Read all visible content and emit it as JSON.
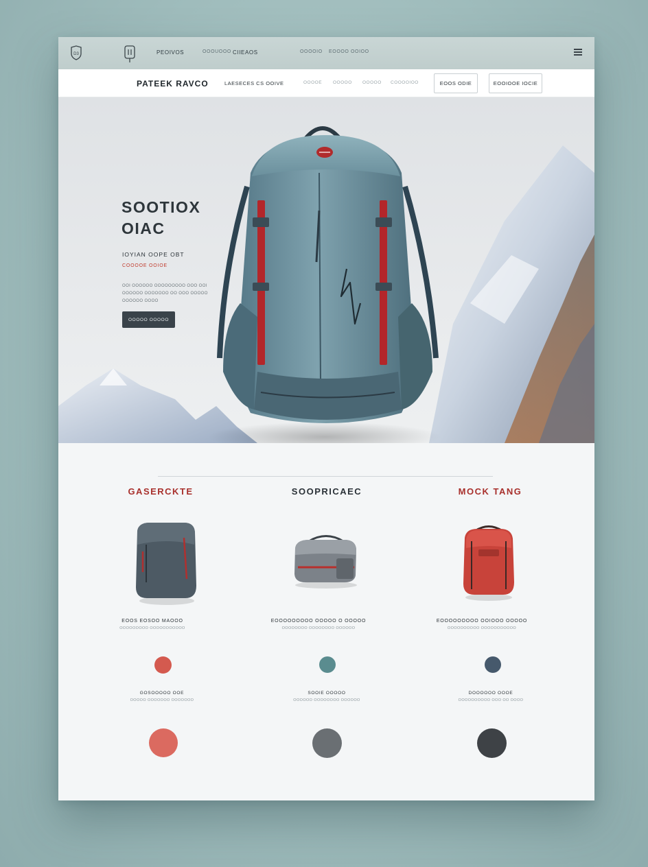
{
  "topbar": {
    "links": [
      "PEOIVOS",
      "OOOUOOO",
      "CIIEAOS",
      "OOOOIO",
      "EOOOO OOIOO"
    ]
  },
  "nav": {
    "brand": "PATEEK RAVCO",
    "primary_link": "LAESECES CS OOIVE",
    "faint_links": [
      "OOOOE",
      "OOOOO",
      "OOOOO",
      "COOOOIOO"
    ],
    "buttons": [
      "EOOS ODIE",
      "EOOIOOE IOCIE"
    ]
  },
  "hero": {
    "title_line1": "SOOTIOX",
    "title_line2": "OIAC",
    "subtitle": "IOYIAN OOPE OBT",
    "tag": "COOOOE OOIOE",
    "desc_lines": [
      "OOI OOOOOO OOOOOOOOO OOO OOI",
      "OOOOOO OOOOOOO OO OOO OOOOO",
      "OOOOOO OOOO"
    ],
    "cta": "OOOOO OOOOO"
  },
  "products": {
    "columns": [
      {
        "title": "GASERCKTE",
        "title_color": "#a8302c",
        "name": "EOOS EOSOO MAOOO",
        "meta": "OOOOOOOOO OOOOOOOOOOO",
        "dot_color": "#d45a4f",
        "small_name": "GOSOOOOO OOE",
        "small_meta": "OOOOO OOOOOOO OOOOOOO",
        "big_color": "#db6a60"
      },
      {
        "title": "SOOPRICAEC",
        "title_color": "#2b3238",
        "name": "EOOOOOOOOO OOOOO O OOOOO",
        "meta": "OOOOOOOO OOOOOOOO OOOOOO",
        "dot_color": "#5a8c8f",
        "small_name": "SOOIE OOOOO",
        "small_meta": "OOOOOO OOOOOOOO OOOOOO",
        "big_color": "#6a6f73"
      },
      {
        "title": "MOCK TANG",
        "title_color": "#a8302c",
        "name": "EOOOOOOOOO OOIOOO OOOOO",
        "meta": "OOOOOOOOOO OOOOOOOOOOO",
        "dot_color": "#46596c",
        "small_name": "DOOOOOO OOOE",
        "small_meta": "OOOOOOOOOO OOO OO OOOO",
        "big_color": "#3e4246"
      }
    ]
  }
}
